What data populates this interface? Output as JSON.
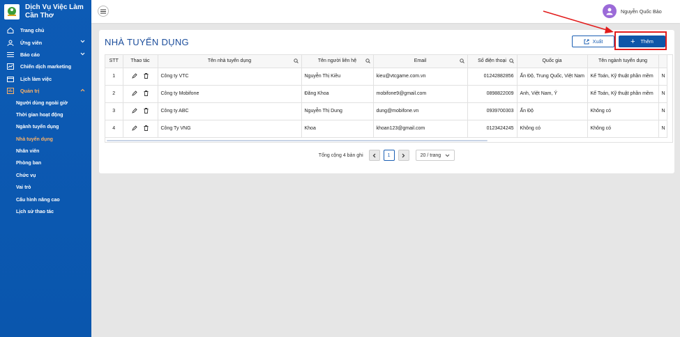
{
  "brand": {
    "title": "Dịch Vụ Việc Làm\nCần Thơ"
  },
  "sidebar": {
    "items": [
      {
        "label": "Trang chủ",
        "icon": "home-icon"
      },
      {
        "label": "Ứng viên",
        "icon": "user-icon",
        "expandable": true
      },
      {
        "label": "Báo cáo",
        "icon": "list-icon",
        "expandable": true
      },
      {
        "label": "Chiến dịch marketing",
        "icon": "marketing-icon"
      },
      {
        "label": "Lịch làm việc",
        "icon": "calendar-icon"
      },
      {
        "label": "Quản trị",
        "icon": "admin-icon",
        "expandable": true,
        "active": true
      }
    ],
    "subitems": [
      {
        "label": "Người dùng ngoài giờ"
      },
      {
        "label": "Thời gian hoạt động"
      },
      {
        "label": "Ngành tuyển dụng"
      },
      {
        "label": "Nhà tuyển dụng",
        "active": true
      },
      {
        "label": "Nhân viên"
      },
      {
        "label": "Phòng ban"
      },
      {
        "label": "Chức vụ"
      },
      {
        "label": "Vai trò"
      },
      {
        "label": "Cấu hình nâng cao"
      },
      {
        "label": "Lịch sử thao tác"
      }
    ]
  },
  "header": {
    "user_name": "Nguyễn Quốc Bảo"
  },
  "page": {
    "title": "NHÀ TUYỂN DỤNG",
    "export_label": "Xuất",
    "add_label": "Thêm"
  },
  "table": {
    "columns": [
      "STT",
      "Thao tác",
      "Tên nhà tuyển dụng",
      "Tên người liên hệ",
      "Email",
      "Số điện thoại",
      "Quốc gia",
      "Tên ngành tuyển dụng",
      ""
    ],
    "rows": [
      {
        "stt": "1",
        "company": "Công ty VTC",
        "contact": "Nguyễn Thị Kiều",
        "email": "kieu@vtcgame.com.vn",
        "phone": "01242882856",
        "country": "Ấn Độ, Trung Quốc, Việt Nam",
        "industry": "Kế Toán, Kỹ thuật phần mềm",
        "extra": "N"
      },
      {
        "stt": "2",
        "company": "Công ty Mobifone",
        "contact": "Đăng Khoa",
        "email": "mobifone9@gmail.com",
        "phone": "0898822009",
        "country": "Anh, Việt Nam, Ý",
        "industry": "Kế Toán, Kỹ thuật phần mềm",
        "extra": "N"
      },
      {
        "stt": "3",
        "company": "Công ty ABC",
        "contact": "Nguyễn Thị Dung",
        "email": "dung@mobifone.vn",
        "phone": "0939700303",
        "country": "Ấn Độ",
        "industry": "Không có",
        "extra": "N"
      },
      {
        "stt": "4",
        "company": "Công Ty VNG",
        "contact": "Khoa",
        "email": "khoan123@gmail.com",
        "phone": "0123424245",
        "country": "Không có",
        "industry": "Không có",
        "extra": "N"
      }
    ]
  },
  "pagination": {
    "total_text": "Tổng cộng 4 bản ghi",
    "current_page": "1",
    "page_size": "20 / trang"
  },
  "colors": {
    "sidebar": "#0d5bb5",
    "accent": "#0f56a8",
    "active_menu": "#ffb366",
    "highlight": "#e21b1b"
  }
}
